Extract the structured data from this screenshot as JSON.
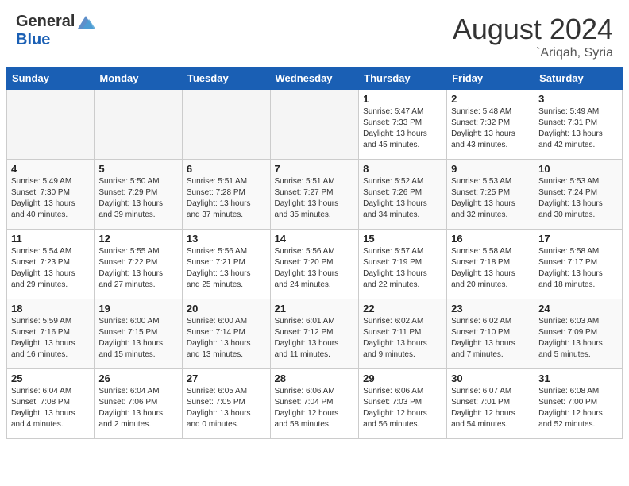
{
  "header": {
    "logo_general": "General",
    "logo_blue": "Blue",
    "month_year": "August 2024",
    "location": "`Ariqah, Syria"
  },
  "weekdays": [
    "Sunday",
    "Monday",
    "Tuesday",
    "Wednesday",
    "Thursday",
    "Friday",
    "Saturday"
  ],
  "weeks": [
    [
      {
        "day": "",
        "info": ""
      },
      {
        "day": "",
        "info": ""
      },
      {
        "day": "",
        "info": ""
      },
      {
        "day": "",
        "info": ""
      },
      {
        "day": "1",
        "info": "Sunrise: 5:47 AM\nSunset: 7:33 PM\nDaylight: 13 hours\nand 45 minutes."
      },
      {
        "day": "2",
        "info": "Sunrise: 5:48 AM\nSunset: 7:32 PM\nDaylight: 13 hours\nand 43 minutes."
      },
      {
        "day": "3",
        "info": "Sunrise: 5:49 AM\nSunset: 7:31 PM\nDaylight: 13 hours\nand 42 minutes."
      }
    ],
    [
      {
        "day": "4",
        "info": "Sunrise: 5:49 AM\nSunset: 7:30 PM\nDaylight: 13 hours\nand 40 minutes."
      },
      {
        "day": "5",
        "info": "Sunrise: 5:50 AM\nSunset: 7:29 PM\nDaylight: 13 hours\nand 39 minutes."
      },
      {
        "day": "6",
        "info": "Sunrise: 5:51 AM\nSunset: 7:28 PM\nDaylight: 13 hours\nand 37 minutes."
      },
      {
        "day": "7",
        "info": "Sunrise: 5:51 AM\nSunset: 7:27 PM\nDaylight: 13 hours\nand 35 minutes."
      },
      {
        "day": "8",
        "info": "Sunrise: 5:52 AM\nSunset: 7:26 PM\nDaylight: 13 hours\nand 34 minutes."
      },
      {
        "day": "9",
        "info": "Sunrise: 5:53 AM\nSunset: 7:25 PM\nDaylight: 13 hours\nand 32 minutes."
      },
      {
        "day": "10",
        "info": "Sunrise: 5:53 AM\nSunset: 7:24 PM\nDaylight: 13 hours\nand 30 minutes."
      }
    ],
    [
      {
        "day": "11",
        "info": "Sunrise: 5:54 AM\nSunset: 7:23 PM\nDaylight: 13 hours\nand 29 minutes."
      },
      {
        "day": "12",
        "info": "Sunrise: 5:55 AM\nSunset: 7:22 PM\nDaylight: 13 hours\nand 27 minutes."
      },
      {
        "day": "13",
        "info": "Sunrise: 5:56 AM\nSunset: 7:21 PM\nDaylight: 13 hours\nand 25 minutes."
      },
      {
        "day": "14",
        "info": "Sunrise: 5:56 AM\nSunset: 7:20 PM\nDaylight: 13 hours\nand 24 minutes."
      },
      {
        "day": "15",
        "info": "Sunrise: 5:57 AM\nSunset: 7:19 PM\nDaylight: 13 hours\nand 22 minutes."
      },
      {
        "day": "16",
        "info": "Sunrise: 5:58 AM\nSunset: 7:18 PM\nDaylight: 13 hours\nand 20 minutes."
      },
      {
        "day": "17",
        "info": "Sunrise: 5:58 AM\nSunset: 7:17 PM\nDaylight: 13 hours\nand 18 minutes."
      }
    ],
    [
      {
        "day": "18",
        "info": "Sunrise: 5:59 AM\nSunset: 7:16 PM\nDaylight: 13 hours\nand 16 minutes."
      },
      {
        "day": "19",
        "info": "Sunrise: 6:00 AM\nSunset: 7:15 PM\nDaylight: 13 hours\nand 15 minutes."
      },
      {
        "day": "20",
        "info": "Sunrise: 6:00 AM\nSunset: 7:14 PM\nDaylight: 13 hours\nand 13 minutes."
      },
      {
        "day": "21",
        "info": "Sunrise: 6:01 AM\nSunset: 7:12 PM\nDaylight: 13 hours\nand 11 minutes."
      },
      {
        "day": "22",
        "info": "Sunrise: 6:02 AM\nSunset: 7:11 PM\nDaylight: 13 hours\nand 9 minutes."
      },
      {
        "day": "23",
        "info": "Sunrise: 6:02 AM\nSunset: 7:10 PM\nDaylight: 13 hours\nand 7 minutes."
      },
      {
        "day": "24",
        "info": "Sunrise: 6:03 AM\nSunset: 7:09 PM\nDaylight: 13 hours\nand 5 minutes."
      }
    ],
    [
      {
        "day": "25",
        "info": "Sunrise: 6:04 AM\nSunset: 7:08 PM\nDaylight: 13 hours\nand 4 minutes."
      },
      {
        "day": "26",
        "info": "Sunrise: 6:04 AM\nSunset: 7:06 PM\nDaylight: 13 hours\nand 2 minutes."
      },
      {
        "day": "27",
        "info": "Sunrise: 6:05 AM\nSunset: 7:05 PM\nDaylight: 13 hours\nand 0 minutes."
      },
      {
        "day": "28",
        "info": "Sunrise: 6:06 AM\nSunset: 7:04 PM\nDaylight: 12 hours\nand 58 minutes."
      },
      {
        "day": "29",
        "info": "Sunrise: 6:06 AM\nSunset: 7:03 PM\nDaylight: 12 hours\nand 56 minutes."
      },
      {
        "day": "30",
        "info": "Sunrise: 6:07 AM\nSunset: 7:01 PM\nDaylight: 12 hours\nand 54 minutes."
      },
      {
        "day": "31",
        "info": "Sunrise: 6:08 AM\nSunset: 7:00 PM\nDaylight: 12 hours\nand 52 minutes."
      }
    ]
  ]
}
